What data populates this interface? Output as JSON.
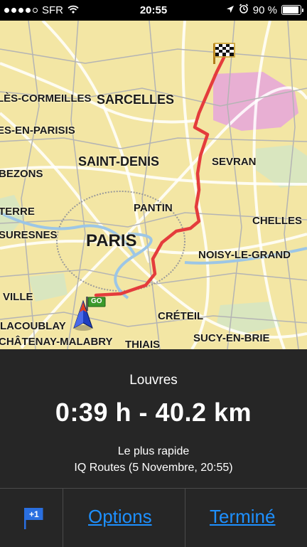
{
  "status": {
    "carrier": "SFR",
    "time": "20:55",
    "battery_percent": "90 %",
    "signal_bars": 4,
    "battery_level": 0.9,
    "icons": [
      "wifi-icon",
      "location-arrow-icon",
      "alarm-icon",
      "battery-icon"
    ]
  },
  "map": {
    "places": [
      "LÈS-CORMEILLES",
      "SARCELLES",
      "ES-EN-PARISIS",
      "SAINT-DENIS",
      "SEVRAN",
      "BEZONS",
      "PANTIN",
      "TERRE",
      "CHELLES",
      "SURESNES",
      "PARIS",
      "NOISY-LE-GRAND",
      "VILLE",
      "CRÉTEIL",
      "LACOUBLAY",
      "SUCY-EN-BRIE",
      "CHÂTENAY-MALABRY",
      "THIAIS"
    ],
    "start_label": "GO",
    "route_color": "#e43c3c",
    "icons": [
      "checkered-flag-icon",
      "go-flag-icon",
      "current-position-arrow-icon"
    ]
  },
  "route": {
    "destination": "Louvres",
    "summary": "0:39 h - 40.2 km",
    "type": "Le plus rapide",
    "info": "IQ Routes (5 Novembre, 20:55)"
  },
  "toolbar": {
    "flag_badge": "+1",
    "options_label": "Options",
    "done_label": "Terminé",
    "link_color": "#1e90ff"
  }
}
